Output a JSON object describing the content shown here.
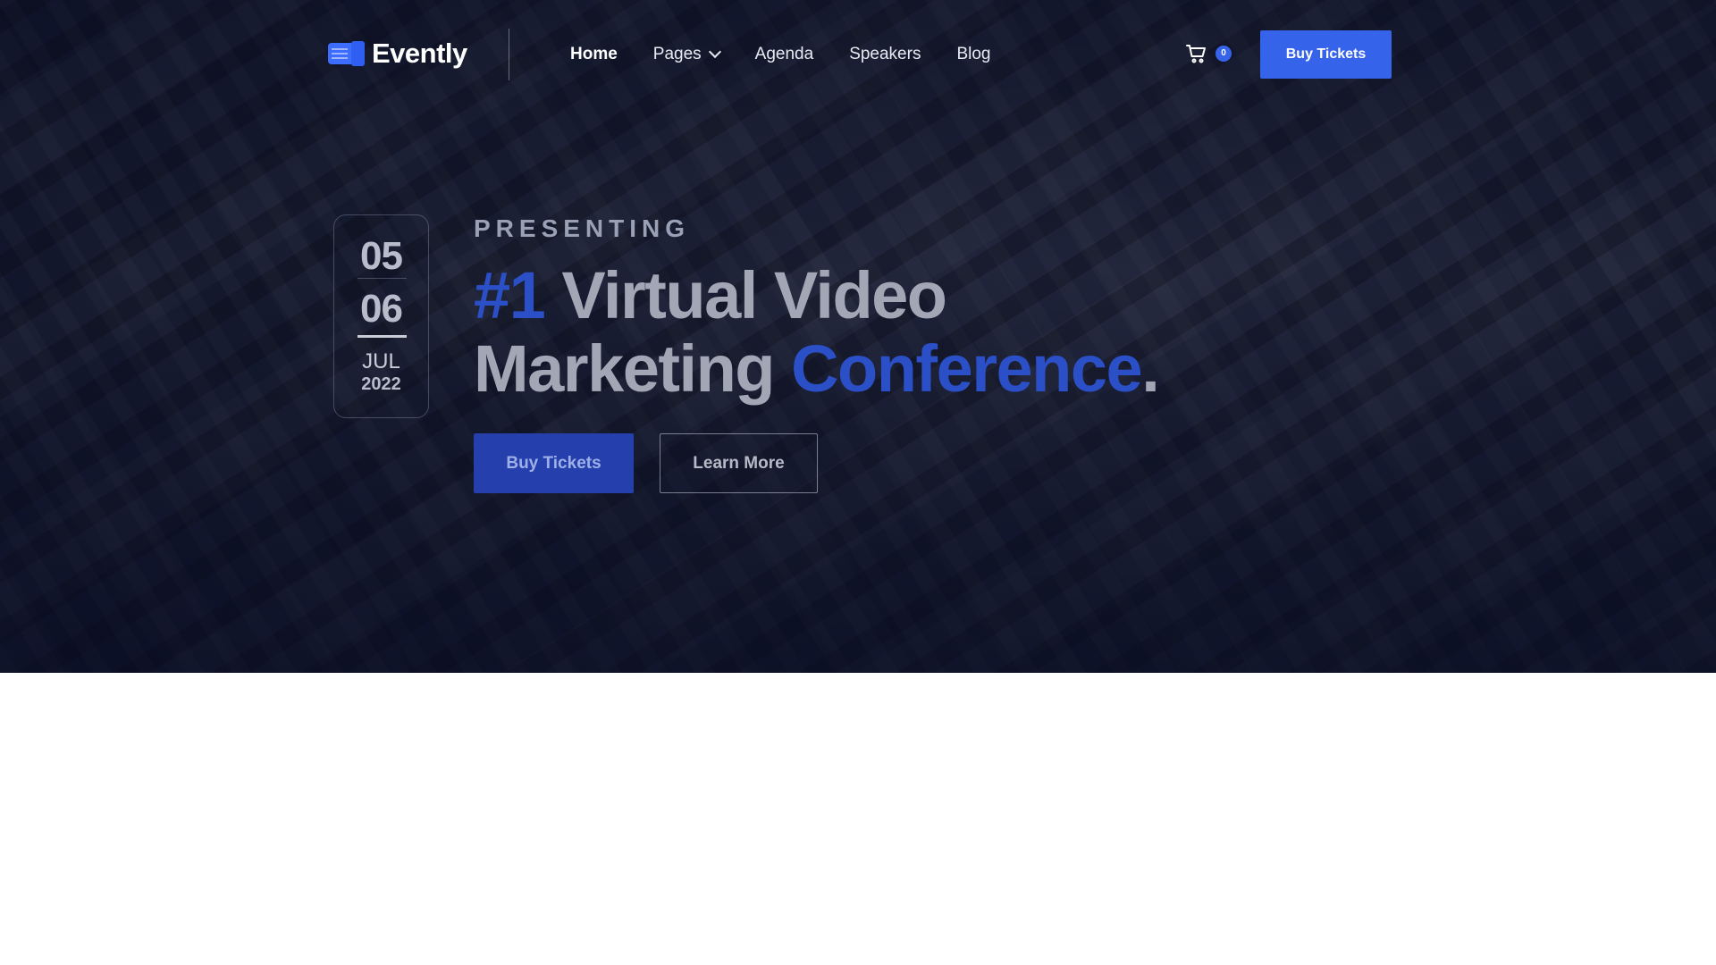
{
  "brand": {
    "name": "Evently"
  },
  "nav": {
    "items": [
      {
        "label": "Home",
        "active": true
      },
      {
        "label": "Pages",
        "has_dropdown": true
      },
      {
        "label": "Agenda"
      },
      {
        "label": "Speakers"
      },
      {
        "label": "Blog"
      }
    ]
  },
  "cart": {
    "count": "0",
    "icon": "cart-icon"
  },
  "header": {
    "cta_label": "Buy Tickets"
  },
  "event_date": {
    "day_start": "05",
    "day_end": "06",
    "month": "JUL",
    "year": "2022"
  },
  "hero": {
    "eyebrow": "PRESENTING",
    "title_part1": "#1",
    "title_part2": " Virtual Video",
    "title_part3": "Marketing ",
    "title_part4": "Conference",
    "title_part5": ".",
    "primary_label": "Buy Tickets",
    "secondary_label": "Learn More"
  },
  "colors": {
    "accent": "#3563e9",
    "hero_bg": "#0d1124"
  }
}
